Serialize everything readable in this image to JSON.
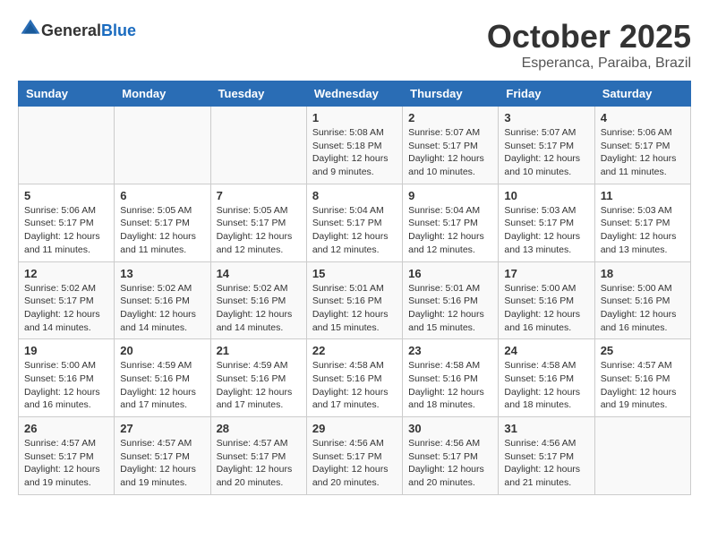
{
  "header": {
    "logo_general": "General",
    "logo_blue": "Blue",
    "title": "October 2025",
    "subtitle": "Esperanca, Paraiba, Brazil"
  },
  "weekdays": [
    "Sunday",
    "Monday",
    "Tuesday",
    "Wednesday",
    "Thursday",
    "Friday",
    "Saturday"
  ],
  "weeks": [
    [
      {
        "day": "",
        "info": ""
      },
      {
        "day": "",
        "info": ""
      },
      {
        "day": "",
        "info": ""
      },
      {
        "day": "1",
        "info": "Sunrise: 5:08 AM\nSunset: 5:18 PM\nDaylight: 12 hours\nand 9 minutes."
      },
      {
        "day": "2",
        "info": "Sunrise: 5:07 AM\nSunset: 5:17 PM\nDaylight: 12 hours\nand 10 minutes."
      },
      {
        "day": "3",
        "info": "Sunrise: 5:07 AM\nSunset: 5:17 PM\nDaylight: 12 hours\nand 10 minutes."
      },
      {
        "day": "4",
        "info": "Sunrise: 5:06 AM\nSunset: 5:17 PM\nDaylight: 12 hours\nand 11 minutes."
      }
    ],
    [
      {
        "day": "5",
        "info": "Sunrise: 5:06 AM\nSunset: 5:17 PM\nDaylight: 12 hours\nand 11 minutes."
      },
      {
        "day": "6",
        "info": "Sunrise: 5:05 AM\nSunset: 5:17 PM\nDaylight: 12 hours\nand 11 minutes."
      },
      {
        "day": "7",
        "info": "Sunrise: 5:05 AM\nSunset: 5:17 PM\nDaylight: 12 hours\nand 12 minutes."
      },
      {
        "day": "8",
        "info": "Sunrise: 5:04 AM\nSunset: 5:17 PM\nDaylight: 12 hours\nand 12 minutes."
      },
      {
        "day": "9",
        "info": "Sunrise: 5:04 AM\nSunset: 5:17 PM\nDaylight: 12 hours\nand 12 minutes."
      },
      {
        "day": "10",
        "info": "Sunrise: 5:03 AM\nSunset: 5:17 PM\nDaylight: 12 hours\nand 13 minutes."
      },
      {
        "day": "11",
        "info": "Sunrise: 5:03 AM\nSunset: 5:17 PM\nDaylight: 12 hours\nand 13 minutes."
      }
    ],
    [
      {
        "day": "12",
        "info": "Sunrise: 5:02 AM\nSunset: 5:17 PM\nDaylight: 12 hours\nand 14 minutes."
      },
      {
        "day": "13",
        "info": "Sunrise: 5:02 AM\nSunset: 5:16 PM\nDaylight: 12 hours\nand 14 minutes."
      },
      {
        "day": "14",
        "info": "Sunrise: 5:02 AM\nSunset: 5:16 PM\nDaylight: 12 hours\nand 14 minutes."
      },
      {
        "day": "15",
        "info": "Sunrise: 5:01 AM\nSunset: 5:16 PM\nDaylight: 12 hours\nand 15 minutes."
      },
      {
        "day": "16",
        "info": "Sunrise: 5:01 AM\nSunset: 5:16 PM\nDaylight: 12 hours\nand 15 minutes."
      },
      {
        "day": "17",
        "info": "Sunrise: 5:00 AM\nSunset: 5:16 PM\nDaylight: 12 hours\nand 16 minutes."
      },
      {
        "day": "18",
        "info": "Sunrise: 5:00 AM\nSunset: 5:16 PM\nDaylight: 12 hours\nand 16 minutes."
      }
    ],
    [
      {
        "day": "19",
        "info": "Sunrise: 5:00 AM\nSunset: 5:16 PM\nDaylight: 12 hours\nand 16 minutes."
      },
      {
        "day": "20",
        "info": "Sunrise: 4:59 AM\nSunset: 5:16 PM\nDaylight: 12 hours\nand 17 minutes."
      },
      {
        "day": "21",
        "info": "Sunrise: 4:59 AM\nSunset: 5:16 PM\nDaylight: 12 hours\nand 17 minutes."
      },
      {
        "day": "22",
        "info": "Sunrise: 4:58 AM\nSunset: 5:16 PM\nDaylight: 12 hours\nand 17 minutes."
      },
      {
        "day": "23",
        "info": "Sunrise: 4:58 AM\nSunset: 5:16 PM\nDaylight: 12 hours\nand 18 minutes."
      },
      {
        "day": "24",
        "info": "Sunrise: 4:58 AM\nSunset: 5:16 PM\nDaylight: 12 hours\nand 18 minutes."
      },
      {
        "day": "25",
        "info": "Sunrise: 4:57 AM\nSunset: 5:16 PM\nDaylight: 12 hours\nand 19 minutes."
      }
    ],
    [
      {
        "day": "26",
        "info": "Sunrise: 4:57 AM\nSunset: 5:17 PM\nDaylight: 12 hours\nand 19 minutes."
      },
      {
        "day": "27",
        "info": "Sunrise: 4:57 AM\nSunset: 5:17 PM\nDaylight: 12 hours\nand 19 minutes."
      },
      {
        "day": "28",
        "info": "Sunrise: 4:57 AM\nSunset: 5:17 PM\nDaylight: 12 hours\nand 20 minutes."
      },
      {
        "day": "29",
        "info": "Sunrise: 4:56 AM\nSunset: 5:17 PM\nDaylight: 12 hours\nand 20 minutes."
      },
      {
        "day": "30",
        "info": "Sunrise: 4:56 AM\nSunset: 5:17 PM\nDaylight: 12 hours\nand 20 minutes."
      },
      {
        "day": "31",
        "info": "Sunrise: 4:56 AM\nSunset: 5:17 PM\nDaylight: 12 hours\nand 21 minutes."
      },
      {
        "day": "",
        "info": ""
      }
    ]
  ]
}
